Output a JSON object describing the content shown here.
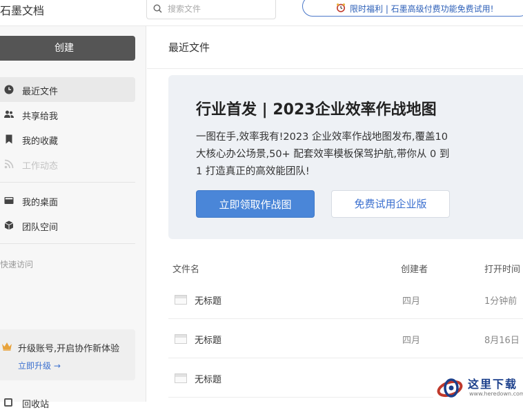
{
  "app": {
    "logo_text": "石墨文档"
  },
  "header": {
    "search_placeholder": "搜索文件",
    "promo_text": "限时福利 | 石墨高级付费功能免费试用!"
  },
  "sidebar": {
    "create_label": "创建",
    "items": [
      {
        "label": "最近文件",
        "icon": "clock-icon",
        "active": true
      },
      {
        "label": "共享给我",
        "icon": "users-icon"
      },
      {
        "label": "我的收藏",
        "icon": "bookmark-icon"
      },
      {
        "label": "工作动态",
        "icon": "rss-icon",
        "disabled": true
      },
      {
        "label": "我的桌面",
        "icon": "desktop-icon"
      },
      {
        "label": "团队空间",
        "icon": "cube-icon"
      }
    ],
    "quick_access_label": "快速访问",
    "upgrade": {
      "title": "升级账号,开启协作新体验",
      "link": "立即升级 →"
    },
    "bottom_item": "回收站"
  },
  "main": {
    "page_title": "最近文件",
    "banner": {
      "title": "行业首发 | 2023企业效率作战地图",
      "description": "一图在手,效率我有!2023 企业效率作战地图发布,覆盖10 大核心办公场景,50+ 配套效率模板保驾护航,带你从 0 到 1 打造真正的高效能团队!",
      "primary_button": "立即领取作战图",
      "secondary_button": "免费试用企业版"
    },
    "table": {
      "headers": {
        "name": "文件名",
        "creator": "创建者",
        "opened": "打开时间"
      },
      "rows": [
        {
          "name": "无标题",
          "creator": "四月",
          "opened": "1分钟前"
        },
        {
          "name": "无标题",
          "creator": "四月",
          "opened": "8月16日"
        },
        {
          "name": "无标题",
          "creator": "",
          "opened": ""
        }
      ]
    }
  },
  "watermark": {
    "title": "这里下载",
    "url": "www.heredown.com"
  },
  "colors": {
    "accent": "#4a86d8",
    "create_button": "#555555",
    "banner_bg": "#eef1f5"
  }
}
